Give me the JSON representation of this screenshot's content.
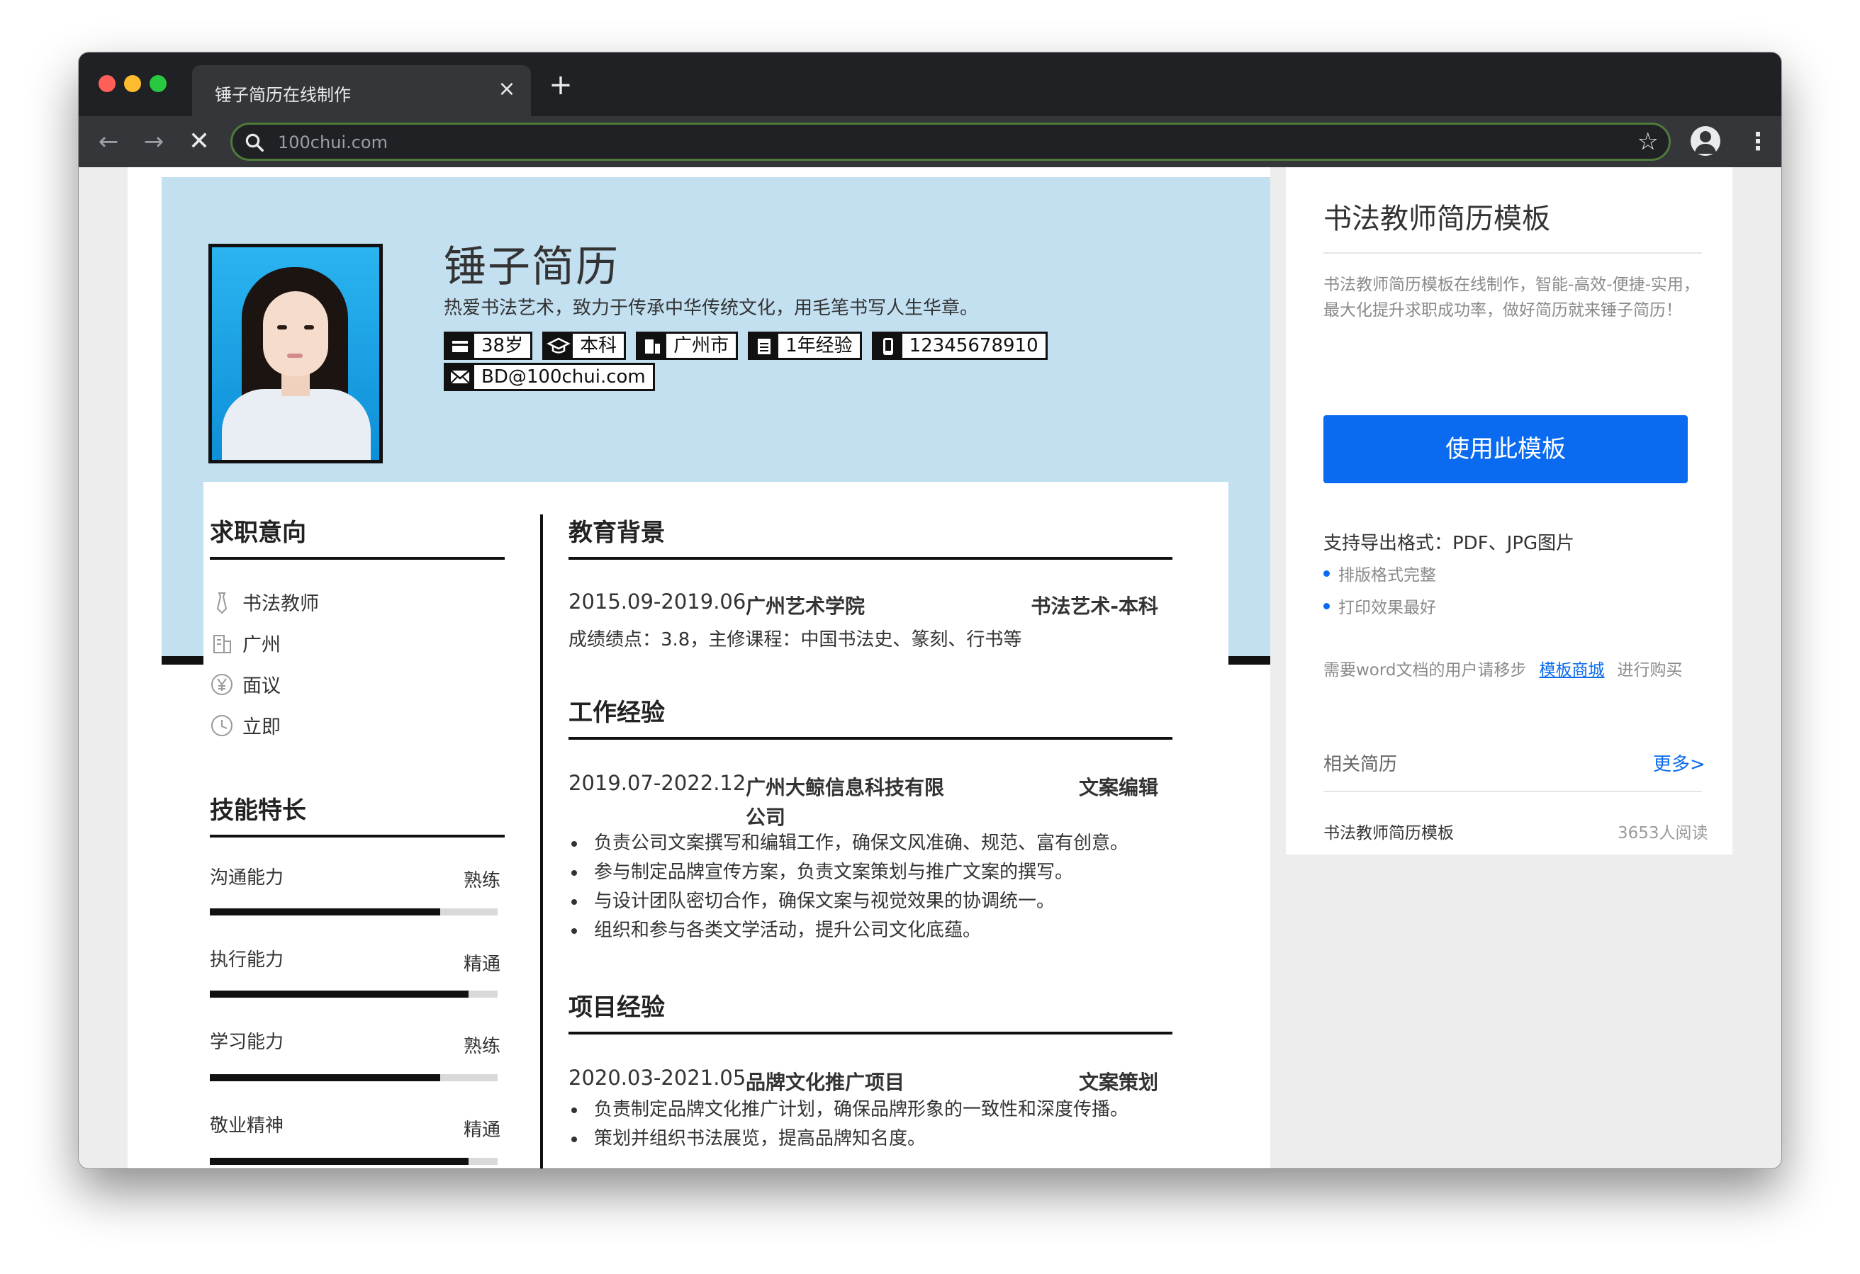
{
  "browser": {
    "tab_title": "锤子简历在线制作",
    "url": "100chui.com"
  },
  "resume": {
    "name": "锤子简历",
    "motto": "热爱书法艺术，致力于传承中华传统文化，用毛笔书写人生华章。",
    "chips": [
      {
        "icon": "calendar-icon",
        "text": "38岁"
      },
      {
        "icon": "graduation-cap-icon",
        "text": "本科"
      },
      {
        "icon": "building-icon",
        "text": "广州市"
      },
      {
        "icon": "clipboard-icon",
        "text": "1年经验"
      },
      {
        "icon": "phone-icon",
        "text": "12345678910"
      }
    ],
    "email_chip": {
      "icon": "mail-icon",
      "text": "BD@100chui.com"
    },
    "intent": {
      "title": "求职意向",
      "items": [
        {
          "icon": "tie-icon",
          "text": "书法教师"
        },
        {
          "icon": "building-icon",
          "text": "广州"
        },
        {
          "icon": "yen-icon",
          "text": "面议"
        },
        {
          "icon": "clock-icon",
          "text": "立即"
        }
      ]
    },
    "skills": {
      "title": "技能特长",
      "items": [
        {
          "name": "沟通能力",
          "level": "熟练",
          "fraction": 0.8
        },
        {
          "name": "执行能力",
          "level": "精通",
          "fraction": 0.9
        },
        {
          "name": "学习能力",
          "level": "熟练",
          "fraction": 0.8
        },
        {
          "name": "敬业精神",
          "level": "精通",
          "fraction": 0.9
        }
      ]
    },
    "education": {
      "title": "教育背景",
      "date": "2015.09-2019.06",
      "school": "广州艺术学院",
      "major": "书法艺术-本科",
      "detail": "成绩绩点：3.8，主修课程：中国书法史、篆刻、行书等"
    },
    "work": {
      "title": "工作经验",
      "date": "2019.07-2022.12",
      "company_line1": "广州大鲸信息科技有限",
      "company_line2": "公司",
      "role": "文案编辑",
      "bullets": [
        "负责公司文案撰写和编辑工作，确保文风准确、规范、富有创意。",
        "参与制定品牌宣传方案，负责文案策划与推广文案的撰写。",
        "与设计团队密切合作，确保文案与视觉效果的协调统一。",
        "组织和参与各类文学活动，提升公司文化底蕴。"
      ]
    },
    "project": {
      "title": "项目经验",
      "date": "2020.03-2021.05",
      "name": "品牌文化推广项目",
      "role": "文案策划",
      "bullets": [
        "负责制定品牌文化推广计划，确保品牌形象的一致性和深度传播。",
        "策划并组织书法展览，提高品牌知名度。"
      ]
    }
  },
  "sidebar": {
    "title": "书法教师简历模板",
    "desc": "书法教师简历模板在线制作，智能-高效-便捷-实用，最大化提升求职成功率，做好简历就来锤子简历！",
    "use_button": "使用此模板",
    "support": "支持导出格式：PDF、JPG图片",
    "features": [
      "排版格式完整",
      "打印效果最好"
    ],
    "word_prefix": "需要word文档的用户请移步",
    "word_link": "模板商城",
    "word_suffix": "进行购买",
    "related_title": "相关简历",
    "more": "更多>",
    "related_items": [
      {
        "title": "书法教师简历模板",
        "reads": "3653人阅读"
      }
    ]
  },
  "colors": {
    "header_bg": "#c3e0f1",
    "accent": "#0b6bf0"
  }
}
